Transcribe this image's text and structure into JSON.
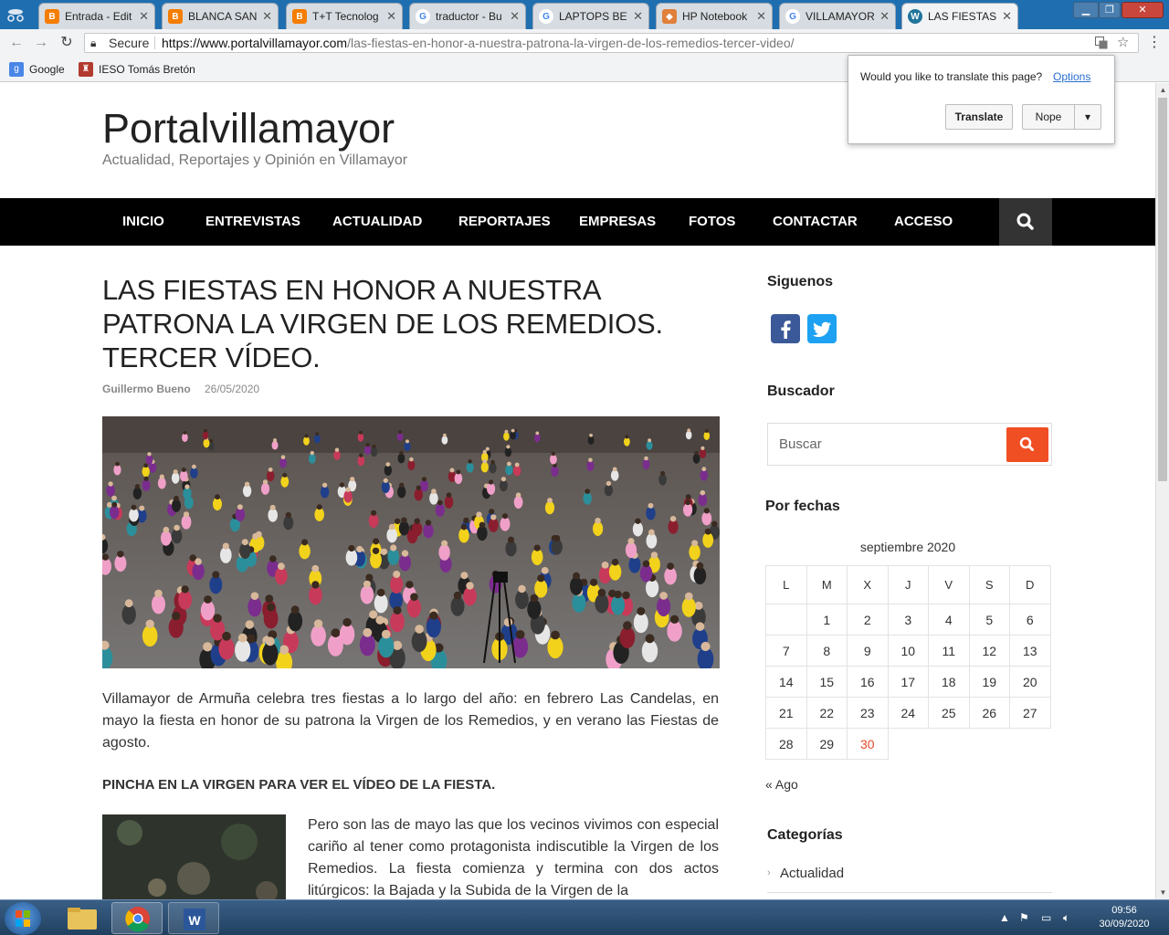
{
  "browser": {
    "tabs": [
      {
        "label": "Entrada - Edit",
        "icon": "blogger-icon",
        "color": "#f57d00"
      },
      {
        "label": "BLANCA SAN",
        "icon": "blogger-icon",
        "color": "#f57d00"
      },
      {
        "label": "T+T Tecnolog",
        "icon": "blogger-icon",
        "color": "#f57d00"
      },
      {
        "label": "traductor - Bu",
        "icon": "google-icon",
        "color": "#ffffff"
      },
      {
        "label": "LAPTOPS BET",
        "icon": "google-icon",
        "color": "#ffffff"
      },
      {
        "label": "HP Notebook",
        "icon": "package-icon",
        "color": "#e0803a"
      },
      {
        "label": "VILLAMAYOR",
        "icon": "google-icon",
        "color": "#ffffff"
      },
      {
        "label": "LAS FIESTAS E",
        "icon": "wordpress-icon",
        "color": "#21759b"
      }
    ],
    "secure_label": "Secure",
    "url_host": "https://www.portalvillamayor.com",
    "url_path": "/las-fiestas-en-honor-a-nuestra-patrona-la-virgen-de-los-remedios-tercer-video/",
    "bookmarks": [
      {
        "label": "Google"
      },
      {
        "label": "IESO Tomás Bretón"
      }
    ]
  },
  "translate_popup": {
    "question": "Would you like to translate this page?",
    "options_label": "Options",
    "translate_label": "Translate",
    "nope_label": "Nope"
  },
  "site": {
    "title": "Portalvillamayor",
    "tagline": "Actualidad, Reportajes y Opinión en Villamayor",
    "nav": [
      "INICIO",
      "ENTREVISTAS",
      "ACTUALIDAD",
      "REPORTAJES",
      "EMPRESAS",
      "FOTOS",
      "CONTACTAR",
      "ACCESO"
    ]
  },
  "post": {
    "title": "LAS FIESTAS EN HONOR A NUESTRA PATRONA LA VIRGEN DE LOS REMEDIOS. TERCER VÍDEO.",
    "author": "Guillermo Bueno",
    "date": "26/05/2020",
    "paragraph1": "Villamayor de Armuña celebra tres fiestas a lo largo del año: en febrero Las Candelas, en mayo la fiesta en honor de su patrona la Virgen de los Remedios, y en verano las Fiestas de agosto.",
    "callout": "PINCHA EN LA VIRGEN PARA VER EL VÍDEO DE LA FIESTA.",
    "paragraph2": "Pero son las de mayo las que los vecinos vivimos con especial cariño al tener como protagonista indiscutible la Virgen de los Remedios. La fiesta comienza y termina con dos actos litúrgicos: la Bajada y la Subida de la Virgen de la"
  },
  "sidebar": {
    "follow_title": "Siguenos",
    "search_title": "Buscador",
    "search_placeholder": "Buscar",
    "dates_title": "Por fechas",
    "calendar": {
      "caption": "septiembre 2020",
      "weekdays": [
        "L",
        "M",
        "X",
        "J",
        "V",
        "S",
        "D"
      ],
      "weeks": [
        [
          "",
          "1",
          "2",
          "3",
          "4",
          "5",
          "6"
        ],
        [
          "7",
          "8",
          "9",
          "10",
          "11",
          "12",
          "13"
        ],
        [
          "14",
          "15",
          "16",
          "17",
          "18",
          "19",
          "20"
        ],
        [
          "21",
          "22",
          "23",
          "24",
          "25",
          "26",
          "27"
        ],
        [
          "28",
          "29",
          "30",
          "",
          "",
          "",
          ""
        ]
      ],
      "today": "30"
    },
    "prev_month": "« Ago",
    "categories_title": "Categorías",
    "categories": [
      "Actualidad"
    ]
  },
  "taskbar": {
    "time": "09:56",
    "date": "30/09/2020"
  }
}
